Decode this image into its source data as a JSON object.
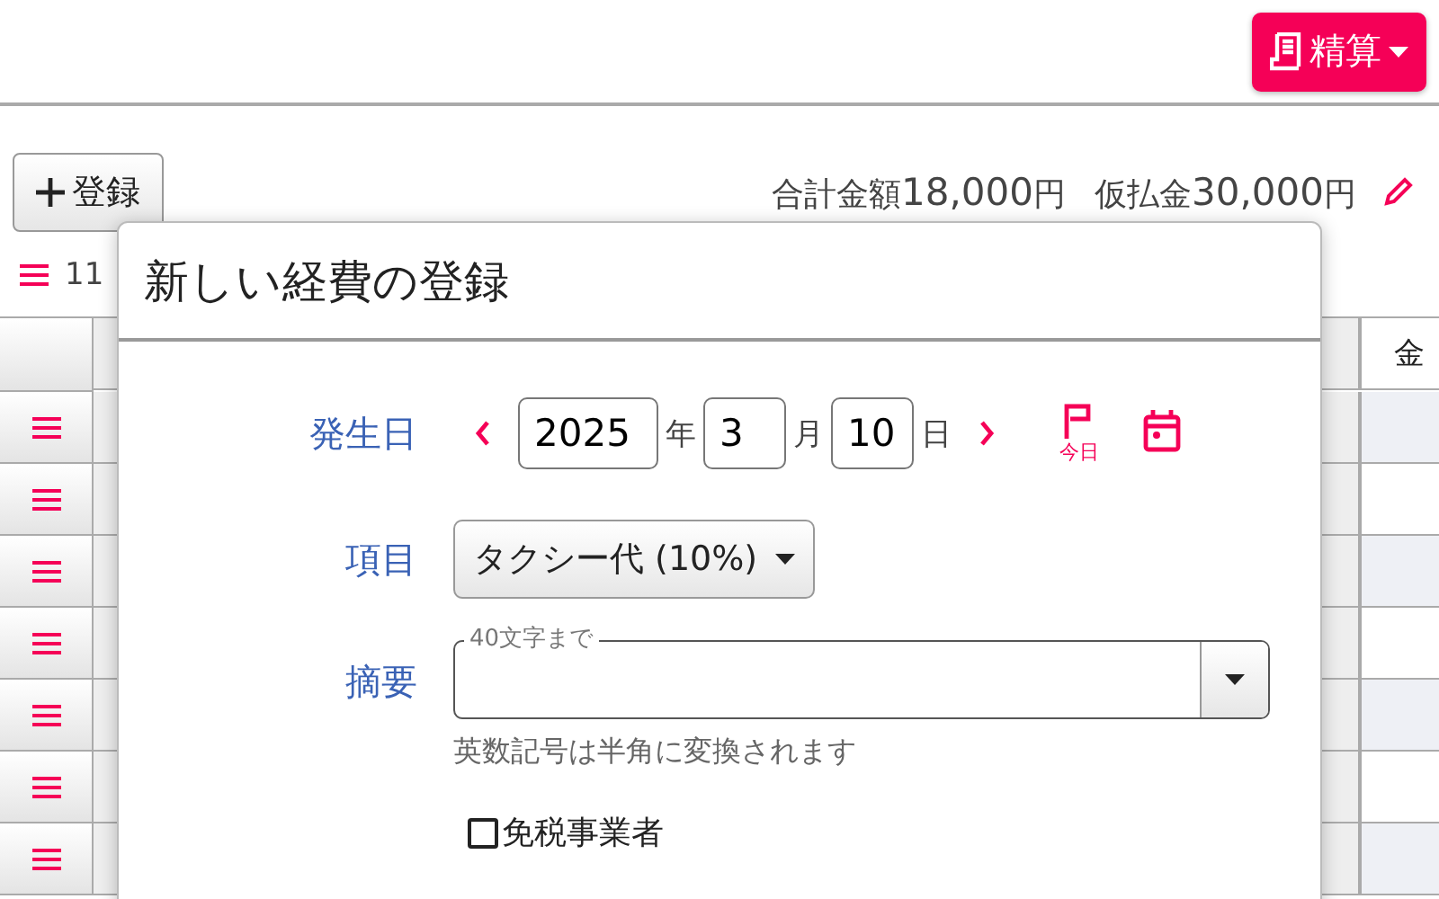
{
  "header": {
    "settle_button": {
      "label": "精算"
    }
  },
  "toolbar": {
    "add_button": {
      "label": "登録"
    },
    "totals": [
      {
        "label": "合計金額",
        "amount": "18,000",
        "unit": "円"
      },
      {
        "label": "仮払金",
        "amount": "30,000",
        "unit": "円"
      }
    ]
  },
  "list_info": {
    "count": "11"
  },
  "table": {
    "last_column_heading": "金",
    "rows": [
      {
        "kind": "entry"
      },
      {
        "kind": "entry"
      },
      {
        "kind": "entry"
      },
      {
        "kind": "entry"
      },
      {
        "kind": "entry"
      },
      {
        "kind": "entry"
      },
      {
        "kind": "entry"
      }
    ]
  },
  "dialog": {
    "title": "新しい経費の登録",
    "date": {
      "label": "発生日",
      "year": "2025",
      "year_unit": "年",
      "month": "3",
      "month_unit": "月",
      "day": "10",
      "day_unit": "日",
      "today_label": "今日"
    },
    "item": {
      "label": "項目",
      "value": "タクシー代 (10%)"
    },
    "summary": {
      "label": "摘要",
      "floating_label": "40文字まで",
      "hint": "英数記号は半角に変換されます"
    },
    "tax_exempt": {
      "label": "免税事業者",
      "checked": false
    }
  }
}
